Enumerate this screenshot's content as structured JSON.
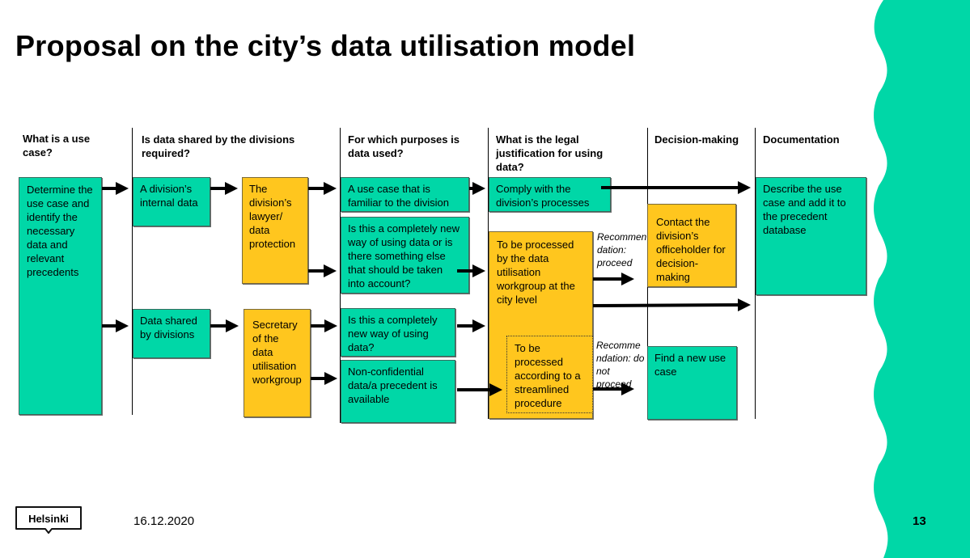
{
  "title": "Proposal on the city’s data utilisation model",
  "columns": [
    {
      "heading": "What is a use case?"
    },
    {
      "heading": "Is data shared by the divisions required?"
    },
    {
      "heading": "For which purposes is data used?"
    },
    {
      "heading": "What is the legal justification for using data?"
    },
    {
      "heading": "Decision-making"
    },
    {
      "heading": "Documentation"
    }
  ],
  "boxes": {
    "determine": "Determine the use case and identify the necessary data and relevant precedents",
    "internal_data": "A division’s internal data",
    "lawyer": "The division’s lawyer/ data protection",
    "shared_data": "Data shared by divisions",
    "secretary": "Secretary of the data utilisation workgroup",
    "familiar": "A use case that is familiar to the division",
    "completely_new_else": "Is this a completely new way of using data or is there something else that should be taken into account?",
    "completely_new": "Is this a completely new way of using data?",
    "non_confidential": "Non-confidential data/a precedent is available",
    "comply": "Comply with the division’s processes",
    "workgroup": "To be processed by the data utilisation workgroup at the city level",
    "streamlined": "To be processed according to a streamlined procedure",
    "contact": "Contact the division’s officeholder for decision-making",
    "find_new": "Find a new use case",
    "describe": "Describe the use case and add it to the precedent database"
  },
  "notes": {
    "proceed": "Recommen dation: proceed",
    "do_not_proceed": "Recomme ndation: do not proceed"
  },
  "footer": {
    "logo_text": "Helsinki",
    "date": "16.12.2020",
    "page_number": "13"
  },
  "colors": {
    "green": "#00d7a7",
    "yellow": "#ffc61e"
  }
}
